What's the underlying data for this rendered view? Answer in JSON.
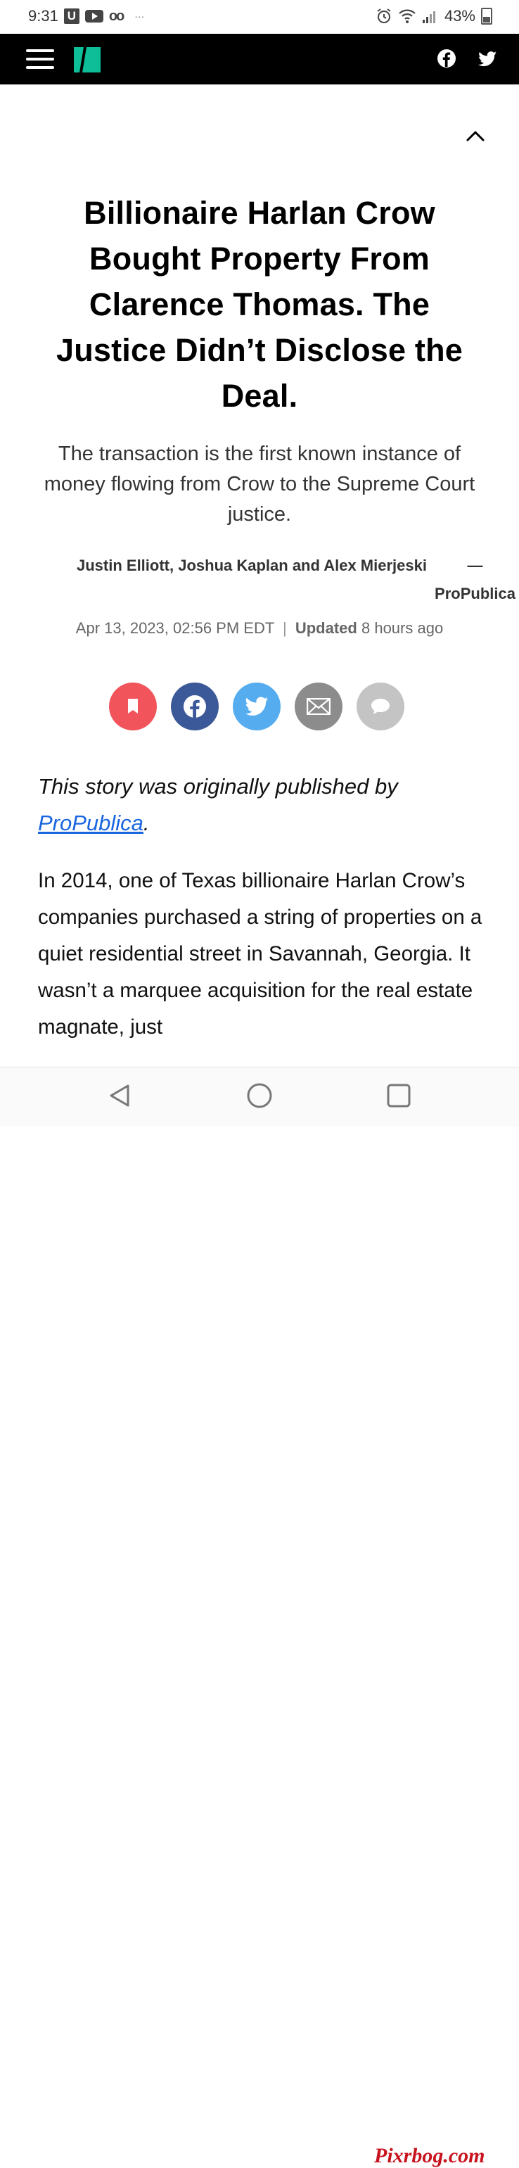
{
  "status_bar": {
    "time": "9:31",
    "u_badge": "U",
    "voicemail": "oo",
    "more": "···",
    "battery": "43%"
  },
  "nav": {
    "logo_icon": "huffpost-logo",
    "facebook_icon": "facebook-icon",
    "twitter_icon": "twitter-icon"
  },
  "article": {
    "headline": "Billionaire Harlan Crow Bought Property From Clarence Thomas. The Justice Didn’t Disclose the Deal.",
    "subhead": "The transaction is the first known instance of money flowing from Crow to the Supreme Court justice.",
    "authors": "Justin Elliott, Joshua Kaplan and Alex Mierjeski",
    "source_dash": "—",
    "source": "ProPublica",
    "date": "Apr 13, 2023, 02:56 PM EDT",
    "date_sep": "|",
    "updated_label": "Updated",
    "updated_value": "8 hours ago",
    "origin_prefix": "This story was originally published by ",
    "origin_link": "ProPublica",
    "origin_suffix": ".",
    "body": "In 2014, one of Texas billionaire Harlan Crow’s companies purchased a string of properties on a quiet residential street in Savannah, Georgia. It wasn’t a marquee acquisition for the real estate magnate, just"
  },
  "share": {
    "colors": {
      "bookmark": "#f2545b",
      "facebook": "#3b5998",
      "twitter": "#55acee",
      "email": "#8c8c8c",
      "comment": "#c4c4c4"
    }
  },
  "watermark": "Pixrbog.com"
}
